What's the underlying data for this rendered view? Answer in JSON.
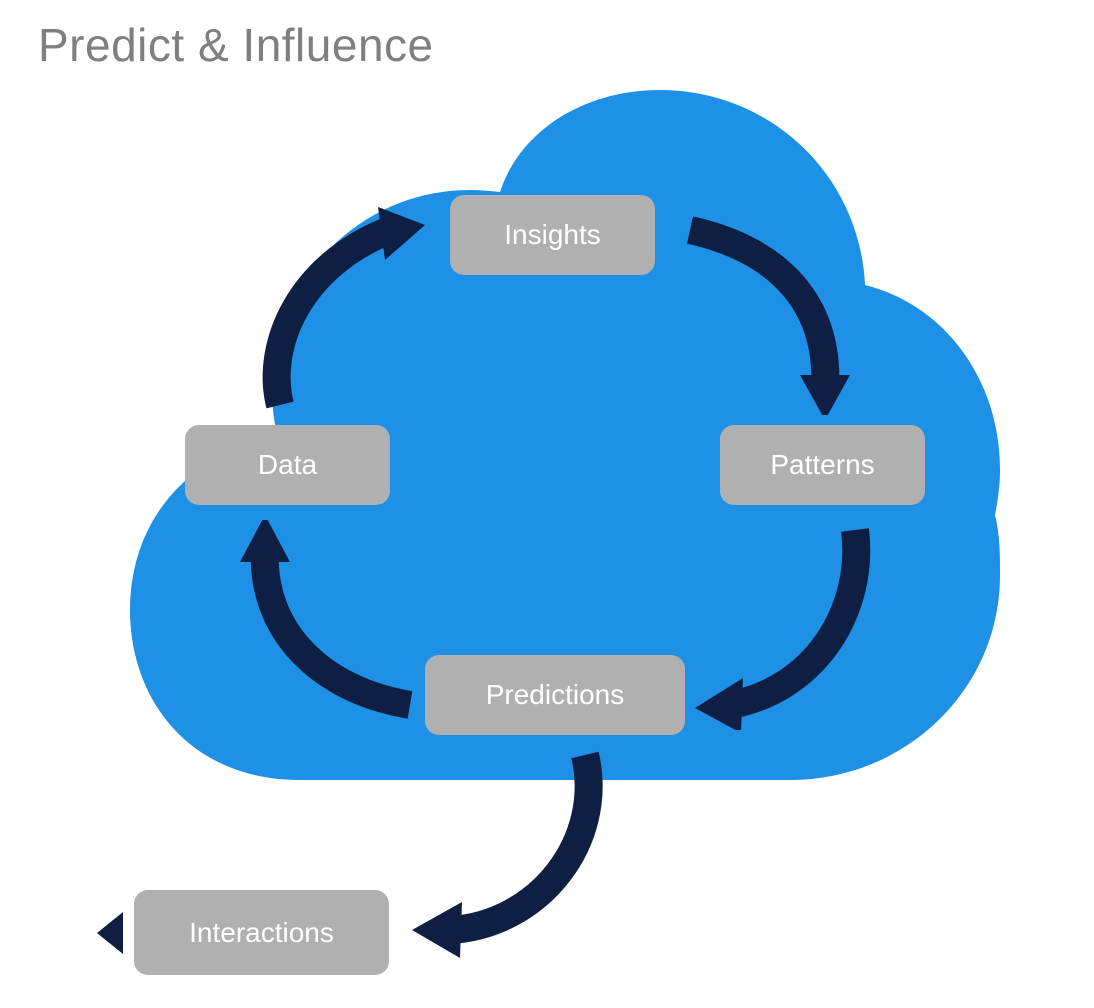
{
  "title": "Predict & Influence",
  "nodes": {
    "insights": "Insights",
    "patterns": "Patterns",
    "predictions": "Predictions",
    "data": "Data",
    "interactions": "Interactions"
  },
  "colors": {
    "cloud": "#1e90e6",
    "arrow": "#0f1f44",
    "node": "#b0b0b0",
    "nodeText": "#ffffff",
    "title": "#7f7f7f"
  }
}
